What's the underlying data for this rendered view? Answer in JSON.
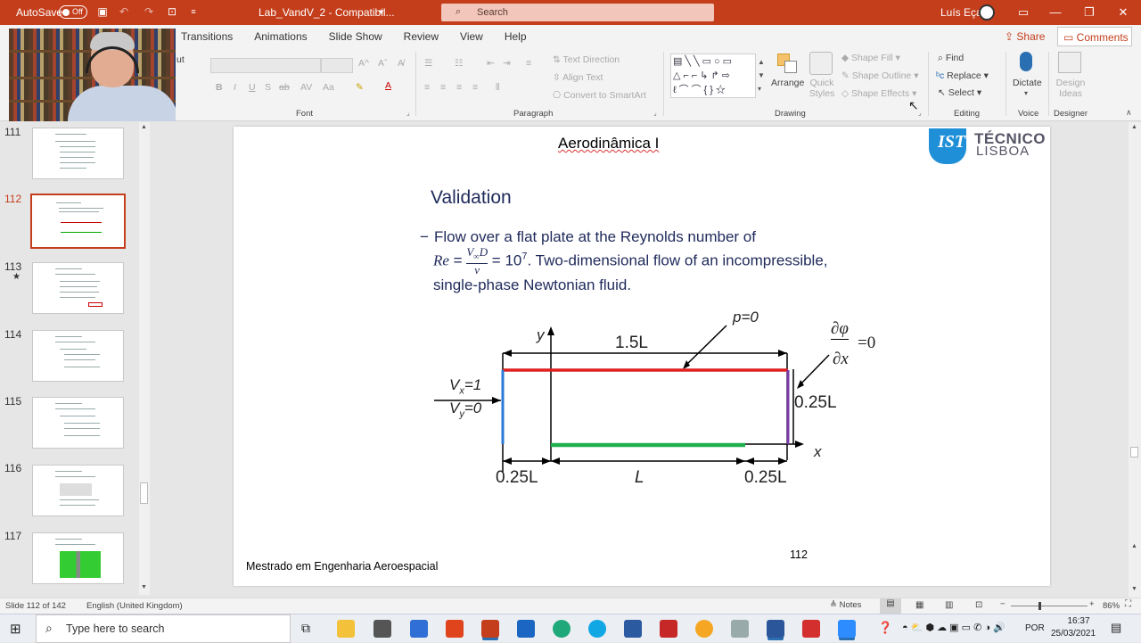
{
  "titlebar": {
    "autosave": "AutoSave",
    "toggle": "Off",
    "filename": "Lab_VandV_2  -  Compatibil...",
    "search_placeholder": "Search",
    "user": "Luís Eça"
  },
  "ribbon": {
    "tabs": [
      "Transitions",
      "Animations",
      "Slide Show",
      "Review",
      "View",
      "Help"
    ],
    "share": "Share",
    "comments": "Comments",
    "clipboard_fragment": "ut",
    "font_group": "Font",
    "paragraph_group": "Paragraph",
    "drawing_group": "Drawing",
    "editing_group": "Editing",
    "voice_group": "Voice",
    "designer_group": "Designer",
    "text_direction": "Text Direction",
    "align_text": "Align Text",
    "convert_smartart": "Convert to SmartArt",
    "arrange": "Arrange",
    "quick_styles": "Quick Styles",
    "shape_fill": "Shape Fill",
    "shape_outline": "Shape Outline",
    "shape_effects": "Shape Effects",
    "find": "Find",
    "replace": "Replace",
    "select": "Select",
    "dictate": "Dictate",
    "design_ideas": "Design Ideas"
  },
  "thumbnails": [
    {
      "num": "111"
    },
    {
      "num": "112"
    },
    {
      "num": "113",
      "star": "★"
    },
    {
      "num": "114"
    },
    {
      "num": "115"
    },
    {
      "num": "116"
    },
    {
      "num": "117"
    }
  ],
  "slide": {
    "header": "Aerodinâmica I",
    "logo_line1": "TÉCNICO",
    "logo_line2": "LISBOA",
    "title": "Validation",
    "bullet_dash": "−",
    "bullet_line1": "Flow over a flat plate at the Reynolds number of",
    "bullet_line2_tail": ". Two-dimensional flow of an incompressible,",
    "bullet_line3": "single-phase Newtonian fluid.",
    "diagram": {
      "y_axis": "y",
      "x_axis": "x",
      "top_length": "1.5L",
      "pressure": "p=0",
      "dphi": "∂φ",
      "dx": "∂x",
      "eq0": "=0",
      "vx": "V",
      "vx_sub": "x",
      "vx_val": "=1",
      "vy": "V",
      "vy_sub": "y",
      "vy_val": "=0",
      "height": "0.25L",
      "left_len": "0.25L",
      "mid_len": "L",
      "right_len": "0.25L"
    },
    "footer": "Mestrado em Engenharia Aeroespacial",
    "page_number": "112"
  },
  "status": {
    "slide_info": "Slide 112 of 142",
    "language": "English (United Kingdom)",
    "notes": "Notes",
    "zoom": "86%"
  },
  "taskbar": {
    "search_placeholder": "Type here to search",
    "lang": "POR",
    "time": "16:37",
    "date": "25/03/2021"
  }
}
